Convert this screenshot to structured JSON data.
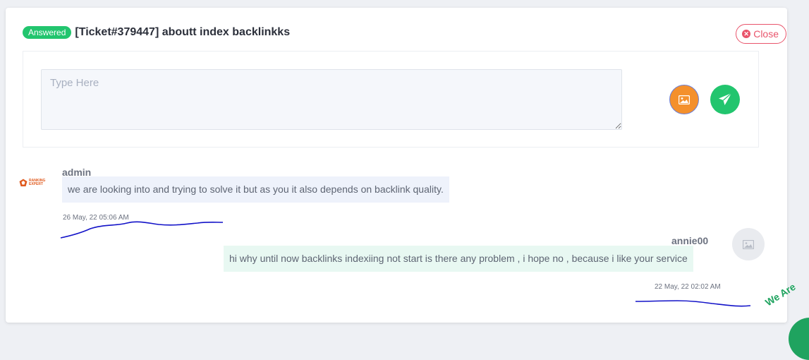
{
  "ticket": {
    "status_badge": "Answered",
    "title": "[Ticket#379447] aboutt index backlinkks",
    "close_label": "Close"
  },
  "reply": {
    "placeholder": "Type Here",
    "value": ""
  },
  "messages": [
    {
      "sender": "admin",
      "avatar_logo": "RANKING EXPERT",
      "text": "we are looking into and trying to solve it but as you it also depends on backlink quality.",
      "timestamp": "26 May, 22 05:06 AM"
    },
    {
      "sender": "annie00",
      "text": "hi why until now backlinks indexiing not start is there any problem , i hope no , because i like your service",
      "timestamp": "22 May, 22 02:02 AM"
    }
  ],
  "corner_widget": {
    "text": "We Are"
  },
  "icons": {
    "close": "close-circle-icon",
    "image": "image-icon",
    "send": "paper-plane-icon",
    "user_avatar": "image-placeholder-icon"
  },
  "colors": {
    "badge": "#22c56e",
    "close": "#e9546b",
    "image_button": "#f4902c",
    "send_button": "#22c56e",
    "scribble": "#1212c8"
  }
}
